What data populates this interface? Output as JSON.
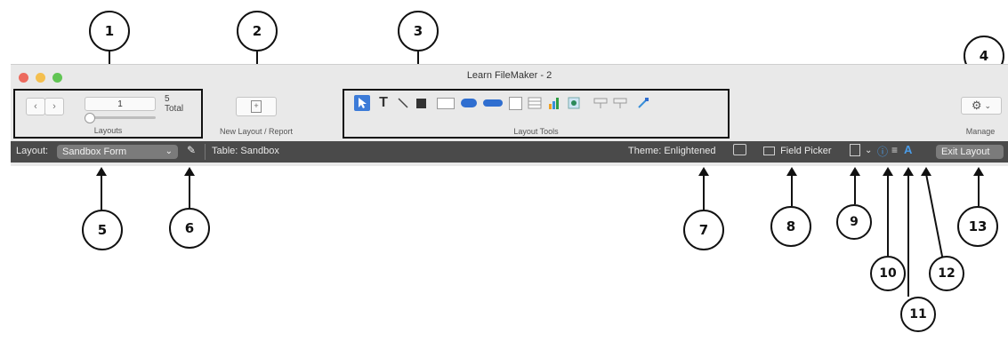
{
  "window": {
    "title": "Learn FileMaker - 2",
    "traffic_colors": [
      "#ec6a5e",
      "#f4bf4f",
      "#61c554"
    ]
  },
  "layouts_group": {
    "current_layout_number": "1",
    "total_count": "5",
    "total_label": "Total",
    "caption": "Layouts"
  },
  "new_layout": {
    "caption": "New Layout / Report"
  },
  "layout_tools": {
    "caption": "Layout Tools",
    "tools": [
      "select-tool",
      "text-tool",
      "line-tool",
      "rectangle-tool",
      "field-tool",
      "button-tool",
      "button-bar-tool",
      "popover-tool",
      "portal-tool",
      "chart-tool",
      "web-viewer-tool",
      "field-control-tool",
      "slide-control-tool",
      "format-painter-tool"
    ]
  },
  "manage": {
    "caption": "Manage"
  },
  "layout_bar": {
    "layout_label": "Layout:",
    "layout_value": "Sandbox Form",
    "table_label": "Table: Sandbox",
    "theme_label": "Theme: Enlightened",
    "field_picker_label": "Field Picker",
    "exit_layout_label": "Exit Layout"
  },
  "callouts": [
    "1",
    "2",
    "3",
    "4",
    "5",
    "6",
    "7",
    "8",
    "9",
    "10",
    "11",
    "12",
    "13"
  ]
}
